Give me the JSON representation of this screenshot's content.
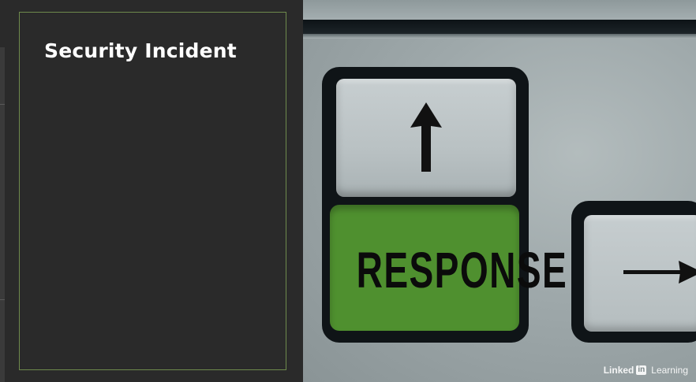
{
  "slide": {
    "title": "Security Incident",
    "frame_color": "#6e8a4c",
    "background_color": "#2a2a2a"
  },
  "photo": {
    "key_label": "RESPONSE",
    "key_color": "#4f902f",
    "up_key_icon": "arrow-up-icon",
    "right_key_icon": "arrow-right-icon"
  },
  "watermark": {
    "brand_a": "Linked",
    "brand_in": "in",
    "brand_b": "Learning"
  }
}
